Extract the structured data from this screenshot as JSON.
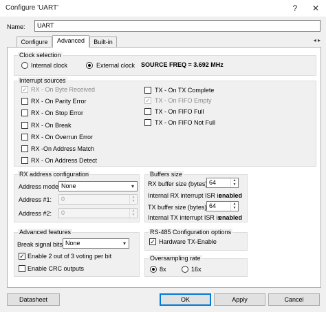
{
  "window": {
    "title": "Configure 'UART'",
    "help_label": "?",
    "close_label": "✕"
  },
  "name": {
    "label": "Name:",
    "value": "UART"
  },
  "tabs": [
    {
      "label": "Configure"
    },
    {
      "label": "Advanced"
    },
    {
      "label": "Built-in"
    }
  ],
  "tab_nav": "◂ ▸",
  "clock": {
    "title": "Clock selection",
    "internal_label": "Internal clock",
    "external_label": "External clock",
    "selected": "External clock",
    "source_freq": "SOURCE FREQ = 3.692 MHz"
  },
  "interrupts": {
    "title": "Interrupt sources",
    "left": [
      {
        "label": "RX - On Byte Received",
        "checked": true,
        "disabled": true
      },
      {
        "label": "RX - On Parity Error",
        "checked": false,
        "disabled": false
      },
      {
        "label": "RX - On Stop Error",
        "checked": false,
        "disabled": false
      },
      {
        "label": "RX - On Break",
        "checked": false,
        "disabled": false
      },
      {
        "label": "RX - On Overrun Error",
        "checked": false,
        "disabled": false
      },
      {
        "label": "RX -On Address Match",
        "checked": false,
        "disabled": false
      },
      {
        "label": "RX - On Address Detect",
        "checked": false,
        "disabled": false
      }
    ],
    "right": [
      {
        "label": "TX - On TX Complete",
        "checked": false,
        "disabled": false
      },
      {
        "label": "TX - On FIFO Empty",
        "checked": true,
        "disabled": true
      },
      {
        "label": "TX - On FIFO Full",
        "checked": false,
        "disabled": false
      },
      {
        "label": "TX - On FIFO Not Full",
        "checked": false,
        "disabled": false
      }
    ]
  },
  "rx_address": {
    "title": "RX address configuration",
    "mode_label": "Address mode:",
    "mode_value": "None",
    "addr1_label": "Address #1:",
    "addr1_value": "0",
    "addr2_label": "Address #2:",
    "addr2_value": "0"
  },
  "buffers": {
    "title": "Buffers size",
    "rx_label": "RX buffer size (bytes):",
    "rx_value": "64",
    "rx_isr_label": "Internal RX interrupt ISR is",
    "rx_isr_value": "enabled",
    "tx_label": "TX buffer size (bytes):",
    "tx_value": "64",
    "tx_isr_label": "Internal TX interrupt ISR is",
    "tx_isr_value": "enabled"
  },
  "advanced": {
    "title": "Advanced features",
    "break_label": "Break signal bits:",
    "break_value": "None",
    "voting_label": "Enable 2 out of 3 voting per bit",
    "voting_checked": true,
    "crc_label": "Enable CRC outputs",
    "crc_checked": false
  },
  "rs485": {
    "title": "RS-485 Configuration options",
    "hw_tx_label": "Hardware TX-Enable",
    "hw_tx_checked": true
  },
  "oversampling": {
    "title": "Oversampling rate",
    "opt_8x": "8x",
    "opt_16x": "16x",
    "selected": "8x"
  },
  "buttons": {
    "datasheet": "Datasheet",
    "ok": "OK",
    "apply": "Apply",
    "cancel": "Cancel"
  },
  "check_glyph": "✓",
  "combo_arrow": "▾",
  "spin_up": "▲",
  "spin_down": "▼"
}
